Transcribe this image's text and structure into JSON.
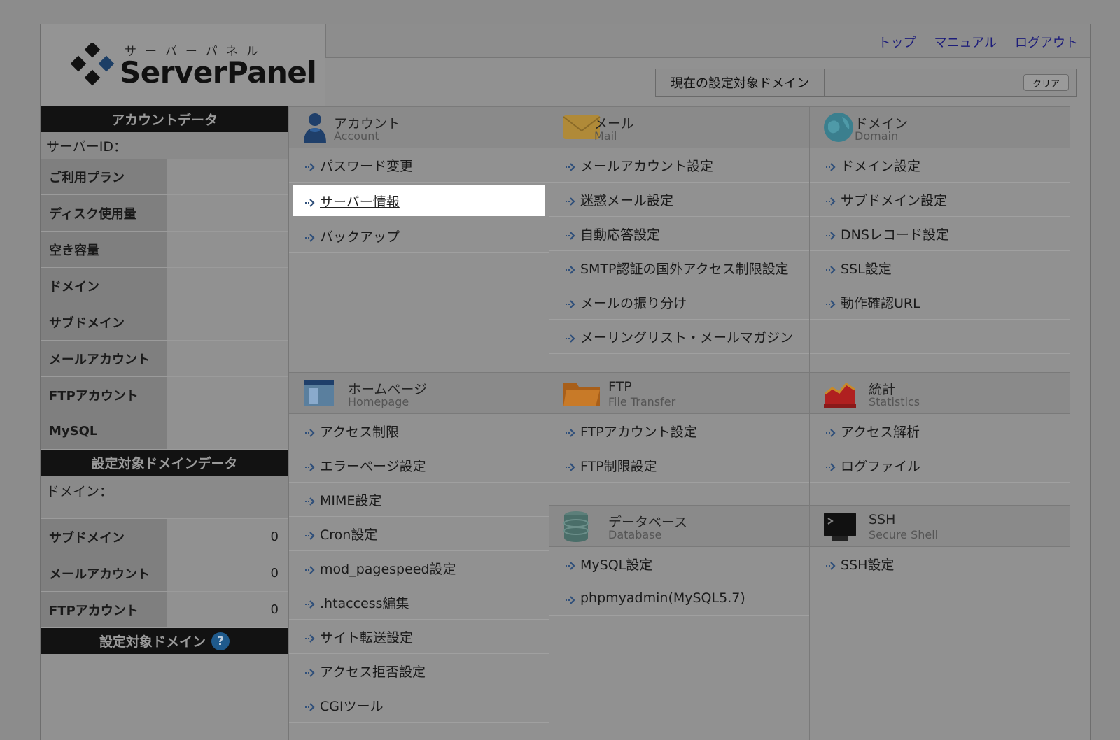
{
  "logo": {
    "kana": "サーバーパネル",
    "name": "ServerPanel"
  },
  "top_links": {
    "top": "トップ",
    "manual": "マニュアル",
    "logout": "ログアウト"
  },
  "current_domain": {
    "label": "現在の設定対象ドメイン",
    "value": "",
    "clear": "クリア"
  },
  "account_data": {
    "heading": "アカウントデータ",
    "server_id_label": "サーバーID：",
    "rows": [
      {
        "label": "ご利用プラン",
        "value": ""
      },
      {
        "label": "ディスク使用量",
        "value": ""
      },
      {
        "label": "空き容量",
        "value": ""
      },
      {
        "label": "ドメイン",
        "value": ""
      },
      {
        "label": "サブドメイン",
        "value": ""
      },
      {
        "label": "メールアカウント",
        "value": ""
      },
      {
        "label": "FTPアカウント",
        "value": ""
      },
      {
        "label": "MySQL",
        "value": ""
      }
    ]
  },
  "target_domain_data": {
    "heading": "設定対象ドメインデータ",
    "domain_label": "ドメイン：",
    "rows": [
      {
        "label": "サブドメイン",
        "value": "0"
      },
      {
        "label": "メールアカウント",
        "value": "0"
      },
      {
        "label": "FTPアカウント",
        "value": "0"
      }
    ]
  },
  "target_domain": {
    "heading": "設定対象ドメイン",
    "help": "?"
  },
  "sections": {
    "account": {
      "title": "アカウント",
      "sub": "Account",
      "items": [
        "パスワード変更",
        "サーバー情報",
        "バックアップ"
      ]
    },
    "mail": {
      "title": "メール",
      "sub": "Mail",
      "items": [
        "メールアカウント設定",
        "迷惑メール設定",
        "自動応答設定",
        "SMTP認証の国外アクセス制限設定",
        "メールの振り分け",
        "メーリングリスト・メールマガジン"
      ]
    },
    "domain": {
      "title": "ドメイン",
      "sub": "Domain",
      "items": [
        "ドメイン設定",
        "サブドメイン設定",
        "DNSレコード設定",
        "SSL設定",
        "動作確認URL"
      ]
    },
    "homepage": {
      "title": "ホームページ",
      "sub": "Homepage",
      "items": [
        "アクセス制限",
        "エラーページ設定",
        "MIME設定",
        "Cron設定",
        "mod_pagespeed設定",
        ".htaccess編集",
        "サイト転送設定",
        "アクセス拒否設定",
        "CGIツール"
      ]
    },
    "ftp": {
      "title": "FTP",
      "sub": "File Transfer",
      "items": [
        "FTPアカウント設定",
        "FTP制限設定"
      ]
    },
    "stats": {
      "title": "統計",
      "sub": "Statistics",
      "items": [
        "アクセス解析",
        "ログファイル"
      ]
    },
    "database": {
      "title": "データベース",
      "sub": "Database",
      "items": [
        "MySQL設定",
        "phpmyadmin(MySQL5.7)"
      ]
    },
    "ssh": {
      "title": "SSH",
      "sub": "Secure Shell",
      "items": [
        "SSH設定"
      ]
    }
  },
  "colors": {
    "background": "#8c8c8c",
    "highlight": "#ffffff",
    "link": "#1d1d7a",
    "sidebar_head": "#121212"
  }
}
